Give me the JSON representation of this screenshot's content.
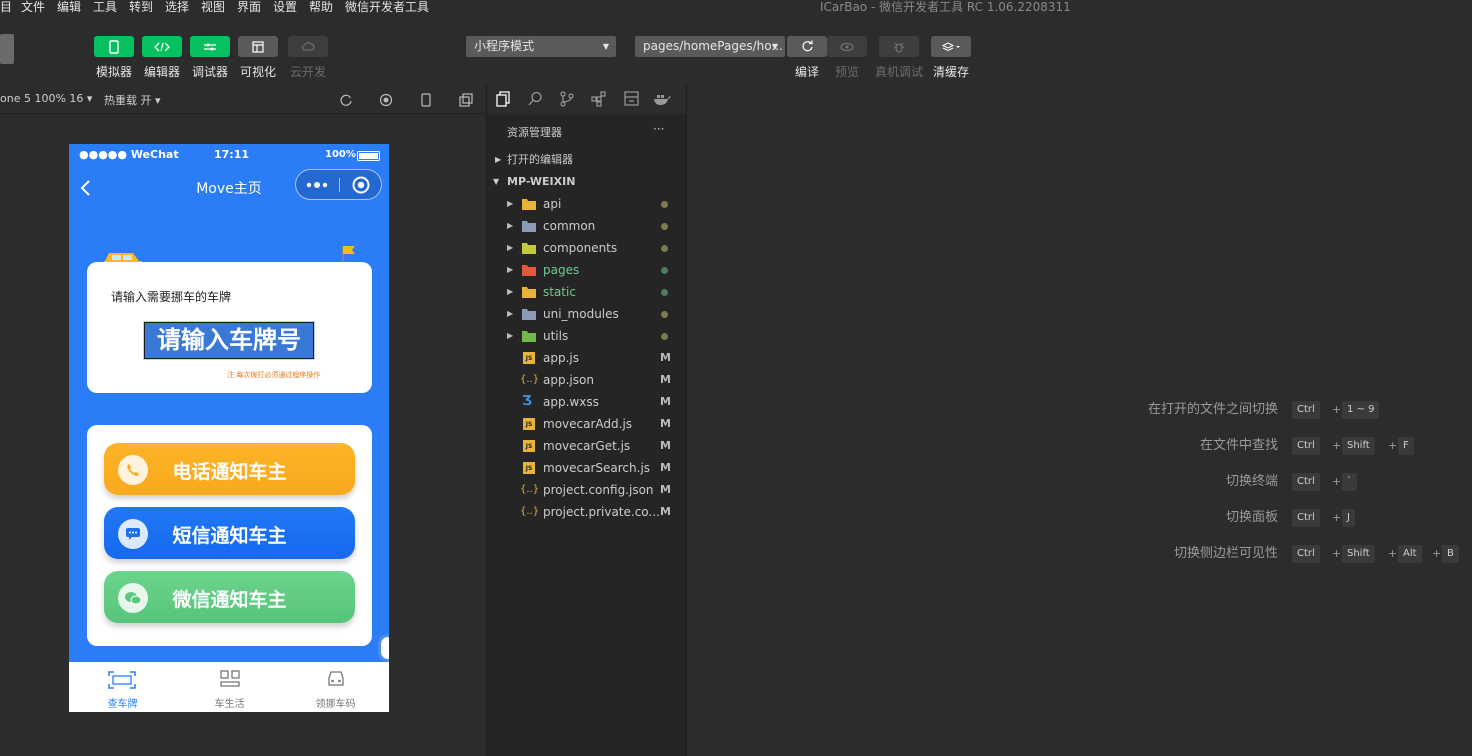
{
  "menu": {
    "items": [
      "目",
      "文件",
      "编辑",
      "工具",
      "转到",
      "选择",
      "视图",
      "界面",
      "设置",
      "帮助",
      "微信开发者工具"
    ],
    "window_title": "ICarBao - 微信开发者工具 RC 1.06.2208311"
  },
  "toolbar": {
    "simulator": "模拟器",
    "editor": "编辑器",
    "debugger": "调试器",
    "visual": "可视化",
    "cloud": "云开发",
    "mode_select": "小程序模式",
    "page_path": "pages/homePages/ho...",
    "compile": "编译",
    "preview": "预览",
    "real_debug": "真机调试",
    "clear_cache": "清缓存"
  },
  "simbar": {
    "device": "one 5 100% 16 ▾",
    "hot_reload": "热重载 开 ▾"
  },
  "phone": {
    "carrier": "●●●●● WeChat",
    "time": "17:11",
    "battery": "100%",
    "nav_title": "Move主页",
    "prompt": "请输入需要挪车的车牌",
    "plate_placeholder": "请输入车牌号",
    "note": "注:每次拨打必须通过程序操作",
    "buttons": [
      {
        "label": "电话通知车主",
        "color": "#fba91e"
      },
      {
        "label": "短信通知车主",
        "color": "#1a6ff2"
      },
      {
        "label": "微信通知车主",
        "color": "#5cc77d"
      }
    ],
    "tabs": [
      "查车牌",
      "车生活",
      "领挪车码"
    ]
  },
  "explorer": {
    "title": "资源管理器",
    "more": "···",
    "open_editors": "打开的编辑器",
    "project": "MP-WEIXIN",
    "folders": [
      {
        "name": "api",
        "color": "#e8b33d",
        "dot": "#7d7a4d",
        "name_color": "#cccccc"
      },
      {
        "name": "common",
        "color": "#8a9bb3",
        "dot": "#7d7a4d",
        "name_color": "#cccccc"
      },
      {
        "name": "components",
        "color": "#c3c93b",
        "dot": "#7d7a4d",
        "name_color": "#cccccc"
      },
      {
        "name": "pages",
        "color": "#e5583f",
        "dot": "#4f7c5a",
        "name_color": "#73c991"
      },
      {
        "name": "static",
        "color": "#e8b33d",
        "dot": "#4f7c5a",
        "name_color": "#73c991"
      },
      {
        "name": "uni_modules",
        "color": "#8a9bb3",
        "dot": "#7d7a4d",
        "name_color": "#cccccc"
      },
      {
        "name": "utils",
        "color": "#72b84a",
        "dot": "#7d7a4d",
        "name_color": "#cccccc"
      }
    ],
    "files": [
      {
        "name": "app.js",
        "icon": "JS",
        "status": "M"
      },
      {
        "name": "app.json",
        "icon": "{..}",
        "status": "M"
      },
      {
        "name": "app.wxss",
        "icon": "css",
        "status": "M"
      },
      {
        "name": "movecarAdd.js",
        "icon": "JS",
        "status": "M"
      },
      {
        "name": "movecarGet.js",
        "icon": "JS",
        "status": "M"
      },
      {
        "name": "movecarSearch.js",
        "icon": "JS",
        "status": "M"
      },
      {
        "name": "project.config.json",
        "icon": "{..}",
        "status": "M"
      },
      {
        "name": "project.private.co...",
        "icon": "{..}",
        "status": "M"
      }
    ]
  },
  "shortcuts": [
    {
      "label": "在打开的文件之间切换",
      "keys": [
        "Ctrl",
        "1 ~ 9"
      ]
    },
    {
      "label": "在文件中查找",
      "keys": [
        "Ctrl",
        "Shift",
        "F"
      ]
    },
    {
      "label": "切换终端",
      "keys": [
        "Ctrl",
        "`"
      ]
    },
    {
      "label": "切换面板",
      "keys": [
        "Ctrl",
        "J"
      ]
    },
    {
      "label": "切换侧边栏可见性",
      "keys": [
        "Ctrl",
        "Shift",
        "Alt",
        "B"
      ]
    }
  ]
}
